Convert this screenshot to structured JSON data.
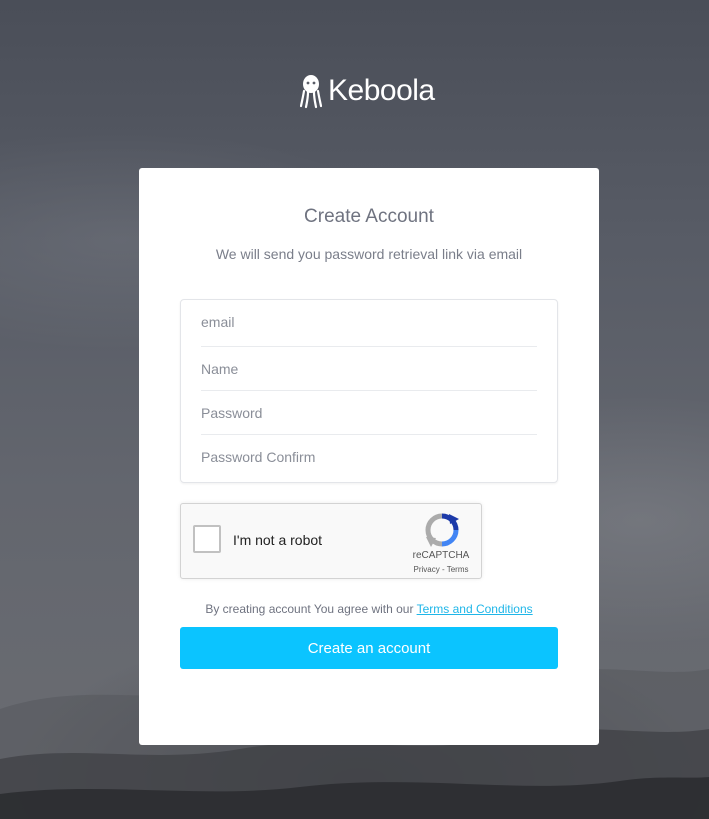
{
  "brand": {
    "name": "Keboola",
    "icon": "keboola-octopus-icon"
  },
  "form": {
    "title": "Create Account",
    "subtitle": "We will send you password retrieval link via email",
    "fields": {
      "email": {
        "placeholder": "email",
        "value": ""
      },
      "name": {
        "placeholder": "Name",
        "value": ""
      },
      "password": {
        "placeholder": "Password",
        "value": ""
      },
      "password_confirm": {
        "placeholder": "Password Confirm",
        "value": ""
      }
    },
    "recaptcha": {
      "label": "I'm not a robot",
      "brand": "reCAPTCHA",
      "links": "Privacy - Terms",
      "icon": "recaptcha-icon"
    },
    "terms": {
      "prefix": "By creating account You agree with our",
      "link": "Terms and Conditions"
    },
    "submit_label": "Create an account"
  },
  "colors": {
    "accent": "#0bc4ff",
    "link": "#1fb6e8",
    "text_muted": "#6f7380"
  }
}
